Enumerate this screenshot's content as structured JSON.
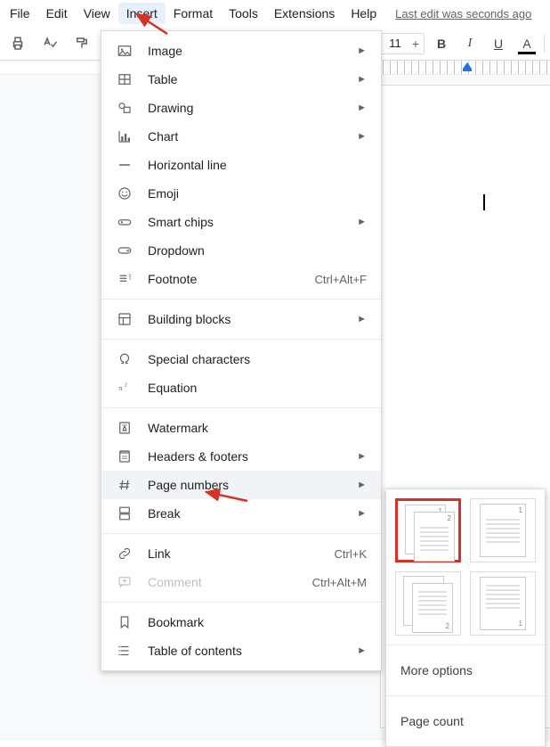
{
  "menubar": {
    "items": [
      "File",
      "Edit",
      "View",
      "Insert",
      "Format",
      "Tools",
      "Extensions",
      "Help"
    ],
    "active_index": 3,
    "last_edit": "Last edit was seconds ago"
  },
  "toolbar": {
    "font_size": "11",
    "bold": "B",
    "italic": "I",
    "underline": "U",
    "text_color": "A"
  },
  "insert_menu": {
    "items": [
      {
        "id": "image",
        "label": "Image",
        "icon": "image-icon",
        "submenu": true
      },
      {
        "id": "table",
        "label": "Table",
        "icon": "table-icon",
        "submenu": true
      },
      {
        "id": "drawing",
        "label": "Drawing",
        "icon": "drawing-icon",
        "submenu": true
      },
      {
        "id": "chart",
        "label": "Chart",
        "icon": "chart-icon",
        "submenu": true
      },
      {
        "id": "hr",
        "label": "Horizontal line",
        "icon": "hr-icon"
      },
      {
        "id": "emoji",
        "label": "Emoji",
        "icon": "emoji-icon"
      },
      {
        "id": "smartchips",
        "label": "Smart chips",
        "icon": "smartchips-icon",
        "submenu": true
      },
      {
        "id": "dropdown",
        "label": "Dropdown",
        "icon": "dropdown-icon"
      },
      {
        "id": "footnote",
        "label": "Footnote",
        "icon": "footnote-icon",
        "shortcut": "Ctrl+Alt+F"
      },
      {
        "sep": true
      },
      {
        "id": "buildingblocks",
        "label": "Building blocks",
        "icon": "buildingblocks-icon",
        "submenu": true
      },
      {
        "sep": true
      },
      {
        "id": "specialchars",
        "label": "Special characters",
        "icon": "omega-icon"
      },
      {
        "id": "equation",
        "label": "Equation",
        "icon": "equation-icon"
      },
      {
        "sep": true
      },
      {
        "id": "watermark",
        "label": "Watermark",
        "icon": "watermark-icon"
      },
      {
        "id": "headersfooters",
        "label": "Headers & footers",
        "icon": "headers-icon",
        "submenu": true
      },
      {
        "id": "pagenumbers",
        "label": "Page numbers",
        "icon": "hash-icon",
        "submenu": true,
        "hover": true
      },
      {
        "id": "break",
        "label": "Break",
        "icon": "break-icon",
        "submenu": true
      },
      {
        "sep": true
      },
      {
        "id": "link",
        "label": "Link",
        "icon": "link-icon",
        "shortcut": "Ctrl+K"
      },
      {
        "id": "comment",
        "label": "Comment",
        "icon": "comment-icon",
        "shortcut": "Ctrl+Alt+M",
        "disabled": true
      },
      {
        "sep": true
      },
      {
        "id": "bookmark",
        "label": "Bookmark",
        "icon": "bookmark-icon"
      },
      {
        "id": "toc",
        "label": "Table of contents",
        "icon": "toc-icon",
        "submenu": true
      }
    ]
  },
  "page_numbers_submenu": {
    "thumbnails": [
      {
        "id": "header-stack",
        "selected": true
      },
      {
        "id": "header-single"
      },
      {
        "id": "footer-stack"
      },
      {
        "id": "footer-single"
      }
    ],
    "more_options": "More options",
    "page_count": "Page count"
  }
}
